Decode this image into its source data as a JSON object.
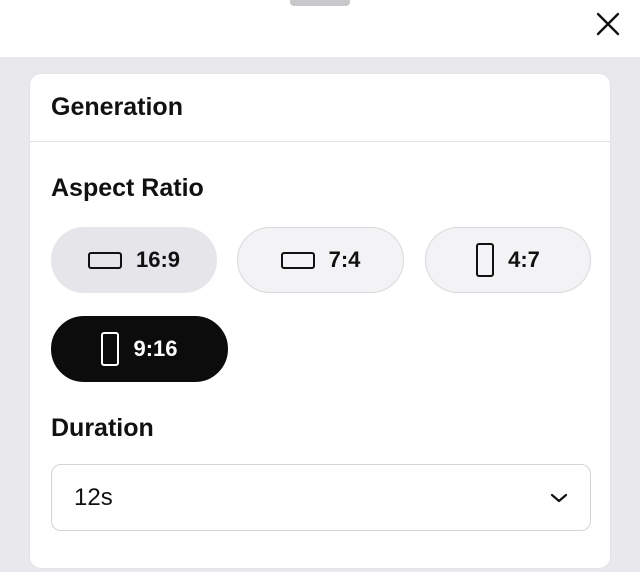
{
  "header": {
    "close_icon": "close-icon"
  },
  "card": {
    "title": "Generation"
  },
  "aspect_ratio": {
    "label": "Aspect Ratio",
    "options": [
      {
        "label": "16:9",
        "icon": "landscape-rect-icon",
        "state": "hover"
      },
      {
        "label": "7:4",
        "icon": "landscape-rect-icon",
        "state": "default"
      },
      {
        "label": "4:7",
        "icon": "portrait-rect-icon",
        "state": "default"
      },
      {
        "label": "9:16",
        "icon": "portrait-rect-icon",
        "state": "selected"
      }
    ]
  },
  "duration": {
    "label": "Duration",
    "value": "12s",
    "icon": "chevron-down-icon"
  },
  "colors": {
    "selected_bg": "#0c0c0c",
    "page_bg": "#e9e8ed",
    "card_bg": "#ffffff"
  }
}
